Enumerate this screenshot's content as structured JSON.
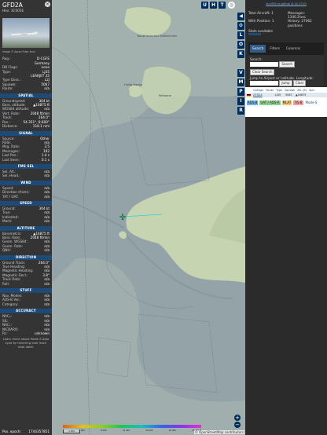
{
  "infobox": {
    "callsign": "GFD2A",
    "hex_label": "Hex:",
    "hex": "3C005E",
    "photo_credit": "Image © Aaron Eden Anul",
    "reg_label": "Reg.:",
    "reg": "D-CGFE",
    "country_label": "",
    "country": "Germany",
    "dbflags_label": "DB Flags:",
    "dbflags": "none",
    "type_label": "Type:",
    "type": "LJ35",
    "type_full": "LEARJET 35",
    "typedesc_label": "Type Desc.:",
    "typedesc": "L2J",
    "squawk_label": "Squawk:",
    "squawk": "5067",
    "route_label": "Route:",
    "route": "n/a",
    "sections": {
      "spatial": "SPATIAL",
      "signal": "SIGNAL",
      "fms": "FMS SEL",
      "wind": "WIND",
      "speed": "SPEED",
      "altitude": "ALTITUDE",
      "direction": "DIRECTION",
      "stuff": "STUFF",
      "accuracy": "ACCURACY"
    },
    "spatial": [
      [
        "Groundspeed:",
        "304 kt"
      ],
      [
        "Baro. altitude:",
        "▲16875 ft"
      ],
      [
        "WGS84 altitude:",
        "n/a"
      ],
      [
        "Vert. Rate:",
        "2048 ft/min"
      ],
      [
        "Track:",
        "264.0°"
      ],
      [
        "Pos.:",
        "54.351°, 8.600°"
      ],
      [
        "Distance:",
        "118.1 nmi"
      ]
    ],
    "signal": [
      [
        "Source:",
        "Other"
      ],
      [
        "RSSI:",
        "n/a"
      ],
      [
        "Msg. Rate:",
        "3.5"
      ],
      [
        "Messages:",
        "192"
      ],
      [
        "Last Pos.:",
        "1.4 s"
      ],
      [
        "Last Seen:",
        "0.1 s"
      ]
    ],
    "fms": [
      [
        "Sel. Alt.:",
        "n/a"
      ],
      [
        "Sel. Head.:",
        "n/a"
      ]
    ],
    "wind": [
      [
        "Speed:",
        "n/a"
      ],
      [
        "Direction (from):",
        "n/a"
      ],
      [
        "TAT / OAT:",
        "n/a"
      ]
    ],
    "speed": [
      [
        "Ground:",
        "304 kt"
      ],
      [
        "True:",
        "n/a"
      ],
      [
        "Indicated:",
        "n/a"
      ],
      [
        "Mach:",
        "n/a"
      ]
    ],
    "altitude": [
      [
        "Barometric:",
        "▲16875 ft"
      ],
      [
        "Baro. Rate:",
        "2048 ft/min"
      ],
      [
        "Geom. WGS84:",
        "n/a"
      ],
      [
        "Geom. Rate:",
        "n/a"
      ],
      [
        "QNH:",
        "n/a"
      ]
    ],
    "direction": [
      [
        "Ground Track:",
        "264.0°"
      ],
      [
        "True Heading:",
        "n/a"
      ],
      [
        "Magnetic Heading:",
        "n/a"
      ],
      [
        "Magnetic Decl.:",
        "3.8°"
      ],
      [
        "Track Rate:",
        "n/a"
      ],
      [
        "Roll:",
        "n/a"
      ]
    ],
    "stuff": [
      [
        "Nav. Modes:",
        "n/a"
      ],
      [
        "ADS-B Ver.:",
        "n/a"
      ],
      [
        "Category:",
        "n/a"
      ]
    ],
    "accuracy": [
      [
        "NACₚ:",
        "n/a"
      ],
      [
        "SIL:",
        "n/a"
      ],
      [
        "NACᵥ:",
        "n/a"
      ],
      [
        "NICBARO:",
        "n/a"
      ],
      [
        "Rc:",
        "unknown"
      ]
    ],
    "note": "Learn more about Mode S data type by hovering over each data label.",
    "epoch_label": "Pos. epoch:",
    "epoch": "1744357851"
  },
  "map": {
    "top_buttons": [
      "U",
      "H",
      "T"
    ],
    "side_buttons": [
      "L",
      "O",
      "K",
      "V",
      "M",
      "P",
      "I",
      "R"
    ],
    "zoom_in": "+",
    "zoom_out": "−",
    "scale": "2 NM",
    "alt_labels": [
      "",
      "6 000",
      "8 000",
      "10 000",
      "20 000",
      "30 000",
      "40 000 ft"
    ],
    "osm": "© OpenStreetMap contributors",
    "place_labels": [
      "Nordfriesisches Wattenmeer",
      "Hallig Hooge",
      "Pellworm"
    ]
  },
  "right": {
    "top_link": "tar1090 on github (3.14.1710)",
    "total_label": "Total Aircraft:",
    "total": "1",
    "messages_label": "Messages:",
    "messages": "1340.2/sec",
    "withpos_label": "With Position:",
    "withpos": "1",
    "history_label": "History:",
    "history": "27062 positions",
    "stats_label": "Stats available",
    "tabs": [
      "Search",
      "Filters",
      "Columns"
    ],
    "search_label": "Search:",
    "search_value": "",
    "search_button": "Search",
    "clear_search": "Clear Search",
    "jump_label": "Jump to Airport or Latitude, Longitude:",
    "jump_button": "Jump",
    "clear_button": "Clear",
    "columns": [
      "Callsign",
      "Route",
      "Type",
      "Squawk",
      "Alt. (ft)",
      "Spd."
    ],
    "row": {
      "callsign": "GFD2A",
      "route": "",
      "type": "LJ35",
      "squawk": "5067",
      "alt": "▲16875"
    },
    "badges": [
      "ADS-B",
      "UAT / ADS-R",
      "MLAT",
      "TIS-B",
      "Mode-S"
    ]
  },
  "colors": {
    "accent": "#1d4a77",
    "button": "#002c5a",
    "land": "#c6d4b2",
    "sea": "#93a3a8"
  }
}
